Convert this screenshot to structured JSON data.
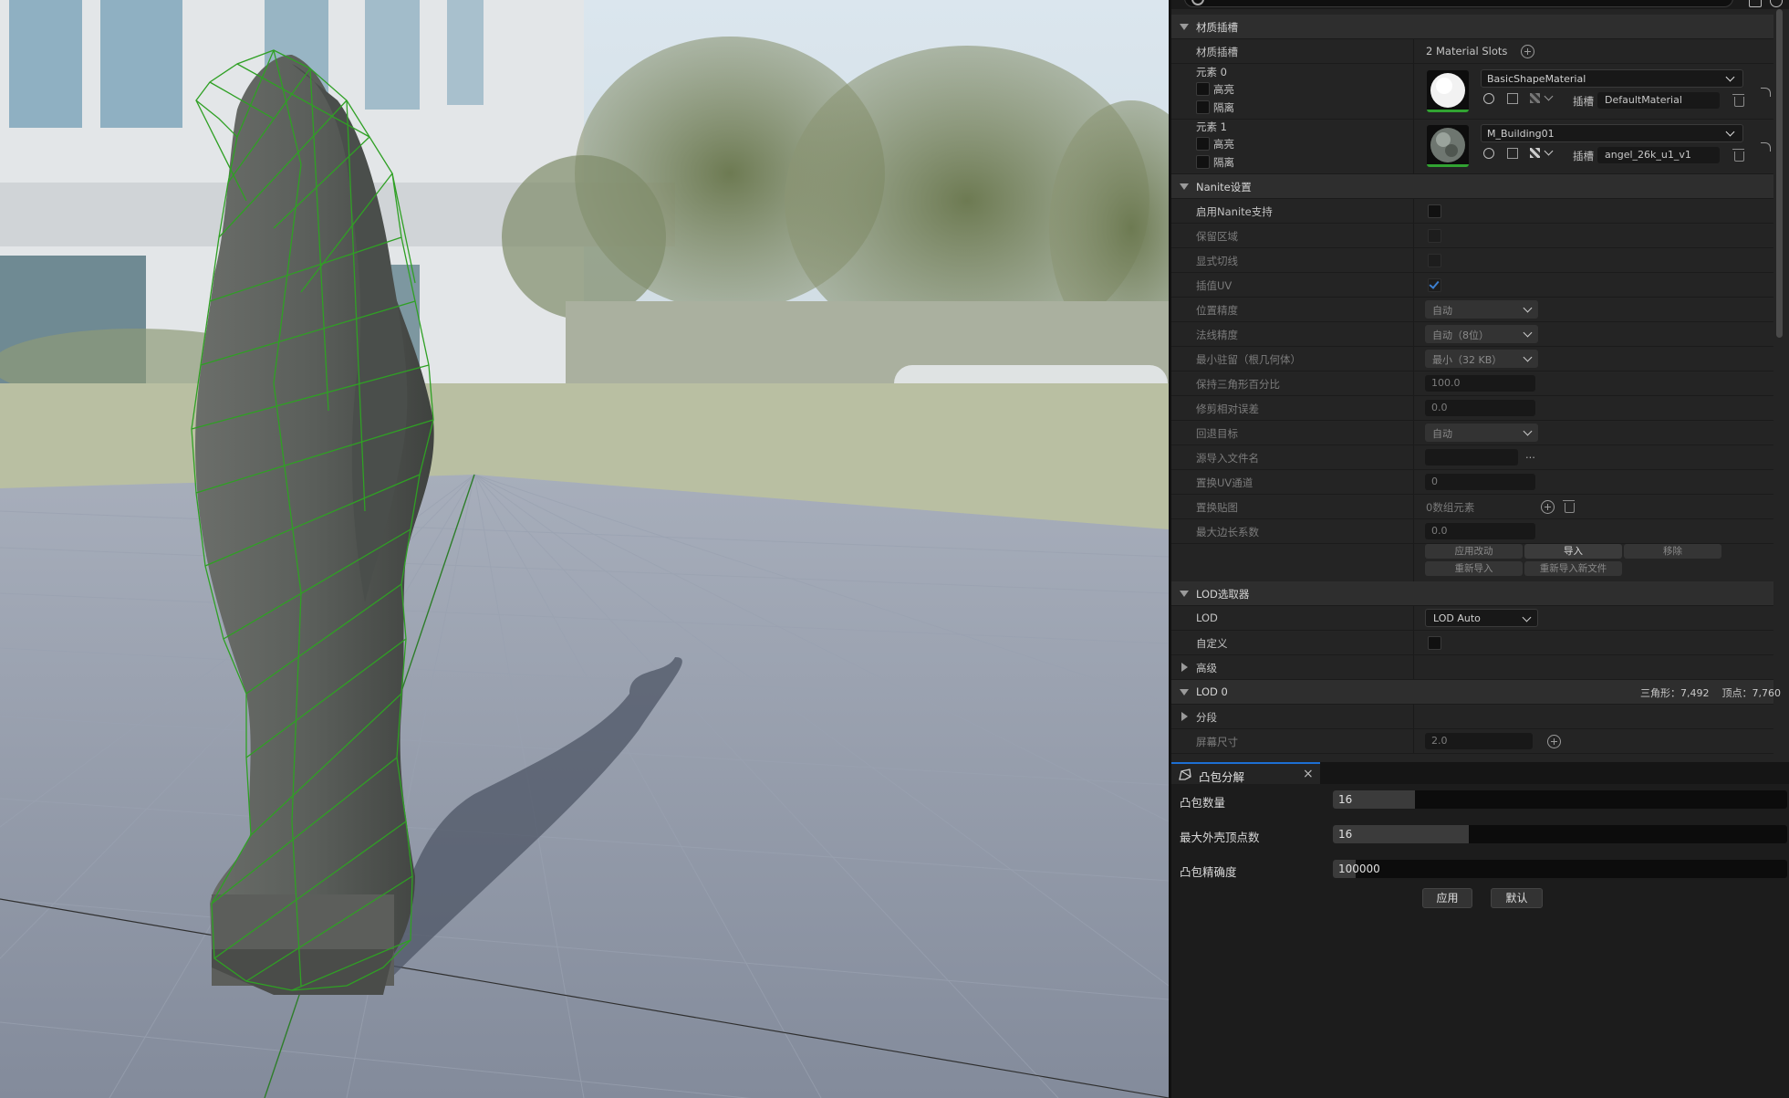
{
  "colors": {
    "accent": "#1d6fd3",
    "thumb_green": "#31a332",
    "wire_green": "#2fa024",
    "check_blue": "#3c7fd0"
  },
  "details": {
    "material_slots": {
      "header": "材质插槽",
      "label": "材质插槽",
      "count": "2 Material Slots",
      "elements": [
        {
          "label": "元素 0",
          "highlight": "高亮",
          "isolate": "隔离",
          "material": "BasicShapeMaterial",
          "slot_label": "插槽",
          "slot_name": "DefaultMaterial"
        },
        {
          "label": "元素 1",
          "highlight": "高亮",
          "isolate": "隔离",
          "material": "M_Building01",
          "slot_label": "插槽",
          "slot_name": "angel_26k_u1_v1"
        }
      ]
    },
    "nanite": {
      "header": "Nanite设置",
      "rows": [
        {
          "label": "启用Nanite支持",
          "kind": "checkbox",
          "checked": false
        },
        {
          "label": "保留区域",
          "kind": "checkbox",
          "checked": false
        },
        {
          "label": "显式切线",
          "kind": "checkbox",
          "checked": false
        },
        {
          "label": "插值UV",
          "kind": "checkbox",
          "checked": true
        },
        {
          "label": "位置精度",
          "kind": "dropdown",
          "value": "自动"
        },
        {
          "label": "法线精度",
          "kind": "dropdown",
          "value": "自动（8位）"
        },
        {
          "label": "最小驻留（根几何体）",
          "kind": "dropdown",
          "value": "最小（32 KB）"
        },
        {
          "label": "保持三角形百分比",
          "kind": "number",
          "value": "100.0"
        },
        {
          "label": "修剪相对误差",
          "kind": "number",
          "value": "0.0"
        },
        {
          "label": "回退目标",
          "kind": "dropdown",
          "value": "自动"
        },
        {
          "label": "源导入文件名",
          "kind": "file",
          "value": "",
          "ellipsis": "..."
        },
        {
          "label": "置换UV通道",
          "kind": "number",
          "value": "0"
        },
        {
          "label": "置换贴图",
          "kind": "array",
          "value": "0数组元素"
        },
        {
          "label": "最大边长系数",
          "kind": "number",
          "value": "0.0"
        }
      ],
      "buttons": {
        "apply": "应用改动",
        "import": "导入",
        "remove": "移除",
        "reimport": "重新导入",
        "reimport_new": "重新导入新文件"
      }
    },
    "lod_picker": {
      "header": "LOD选取器",
      "lod_label": "LOD",
      "lod_value": "LOD Auto",
      "custom_label": "自定义",
      "advanced_label": "高级"
    },
    "lod0": {
      "header": "LOD 0",
      "stats": "三角形：7,492    顶点：7,760",
      "sections_label": "分段",
      "screen_size_label": "屏幕尺寸",
      "screen_size_value": "2.0"
    }
  },
  "convex": {
    "tab_title": "凸包分解",
    "close": "×",
    "hull_count_label": "凸包数量",
    "hull_count": 16,
    "hull_count_fill": 0.18,
    "max_verts_label": "最大外壳顶点数",
    "max_verts": 16,
    "max_verts_fill": 0.3,
    "precision_label": "凸包精确度",
    "precision": 100000,
    "precision_fill": 0.05,
    "apply": "应用",
    "default": "默认"
  }
}
